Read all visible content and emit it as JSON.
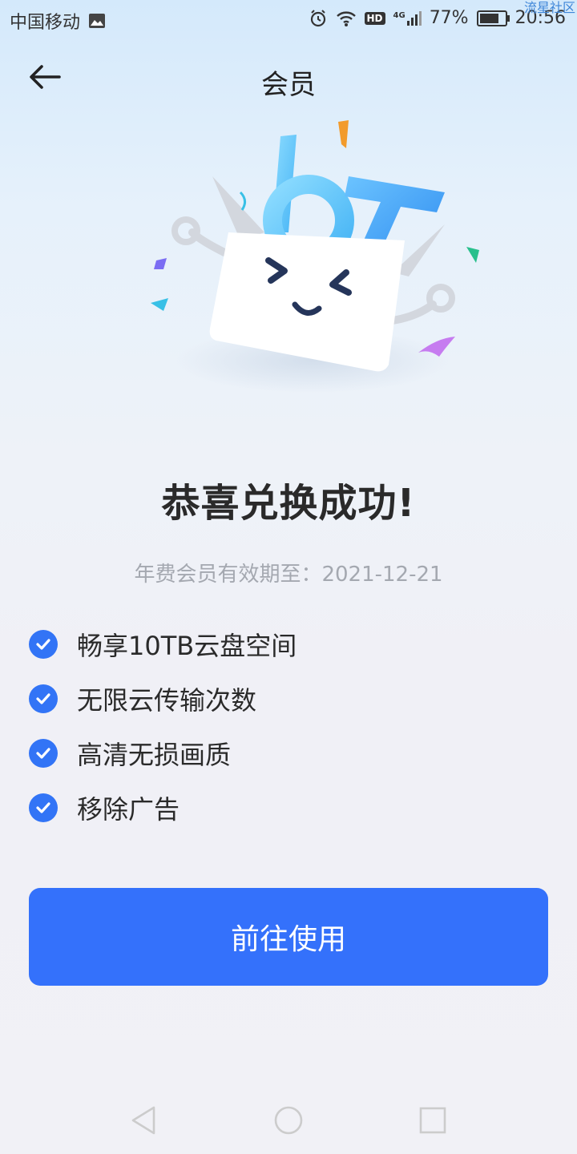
{
  "status_bar": {
    "carrier": "中国移动",
    "network": "4G",
    "battery": "77%",
    "battery_level": 0.77,
    "time": "20:56",
    "hd_label": "HD",
    "watermark": "流星社区"
  },
  "header": {
    "title": "会员"
  },
  "result": {
    "headline": "恭喜兑换成功!",
    "expiry": "年费会员有效期至：2021-12-21"
  },
  "benefits": [
    "畅享10TB云盘空间",
    "无限云传输次数",
    "高清无损画质",
    "移除广告"
  ],
  "cta": {
    "label": "前往使用"
  },
  "colors": {
    "accent": "#3471fb",
    "check": "#3274f6"
  }
}
